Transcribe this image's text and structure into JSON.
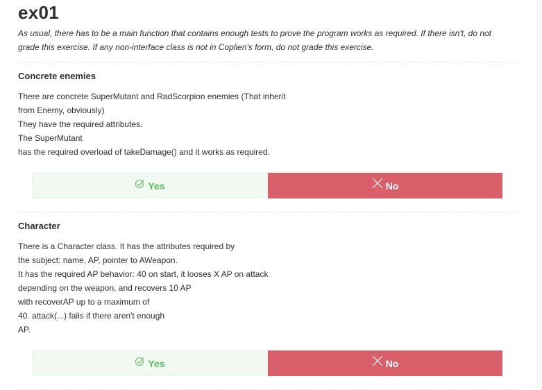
{
  "exercise": {
    "title": "ex01",
    "intro": "As usual, there has to be a main function that contains enough tests to prove the program works as required. If there isn't, do not grade this exercise. If any non-interface class is not in Coplien's form, do not grade this exercise."
  },
  "sections": [
    {
      "title": "Concrete enemies",
      "text": "There are concrete SuperMutant and RadScorpion enemies (That inherit\nfrom Enemy, obviously)\nThey have the required attributes.\nThe SuperMutant\nhas the required overload of takeDamage() and it works as required.",
      "yes_label": "Yes",
      "no_label": "No"
    },
    {
      "title": "Character",
      "text": "There is a Character class. It has the attributes required by\nthe subject: name, AP, pointer to AWeapon.\nIt has the required AP behavior: 40 on start, it looses X AP on attack\ndepending on the weapon, and recovers 10 AP\nwith recoverAP up to a maximum of\n40. attack(...) fails if there aren't enough\nAP.",
      "yes_label": "Yes",
      "no_label": "No"
    }
  ],
  "icons": {
    "yes": "check-circle-icon",
    "no": "x-icon"
  },
  "colors": {
    "yes_text": "#5cb85c",
    "yes_bg": "#f2f9f2",
    "no_bg": "#d9606b"
  }
}
